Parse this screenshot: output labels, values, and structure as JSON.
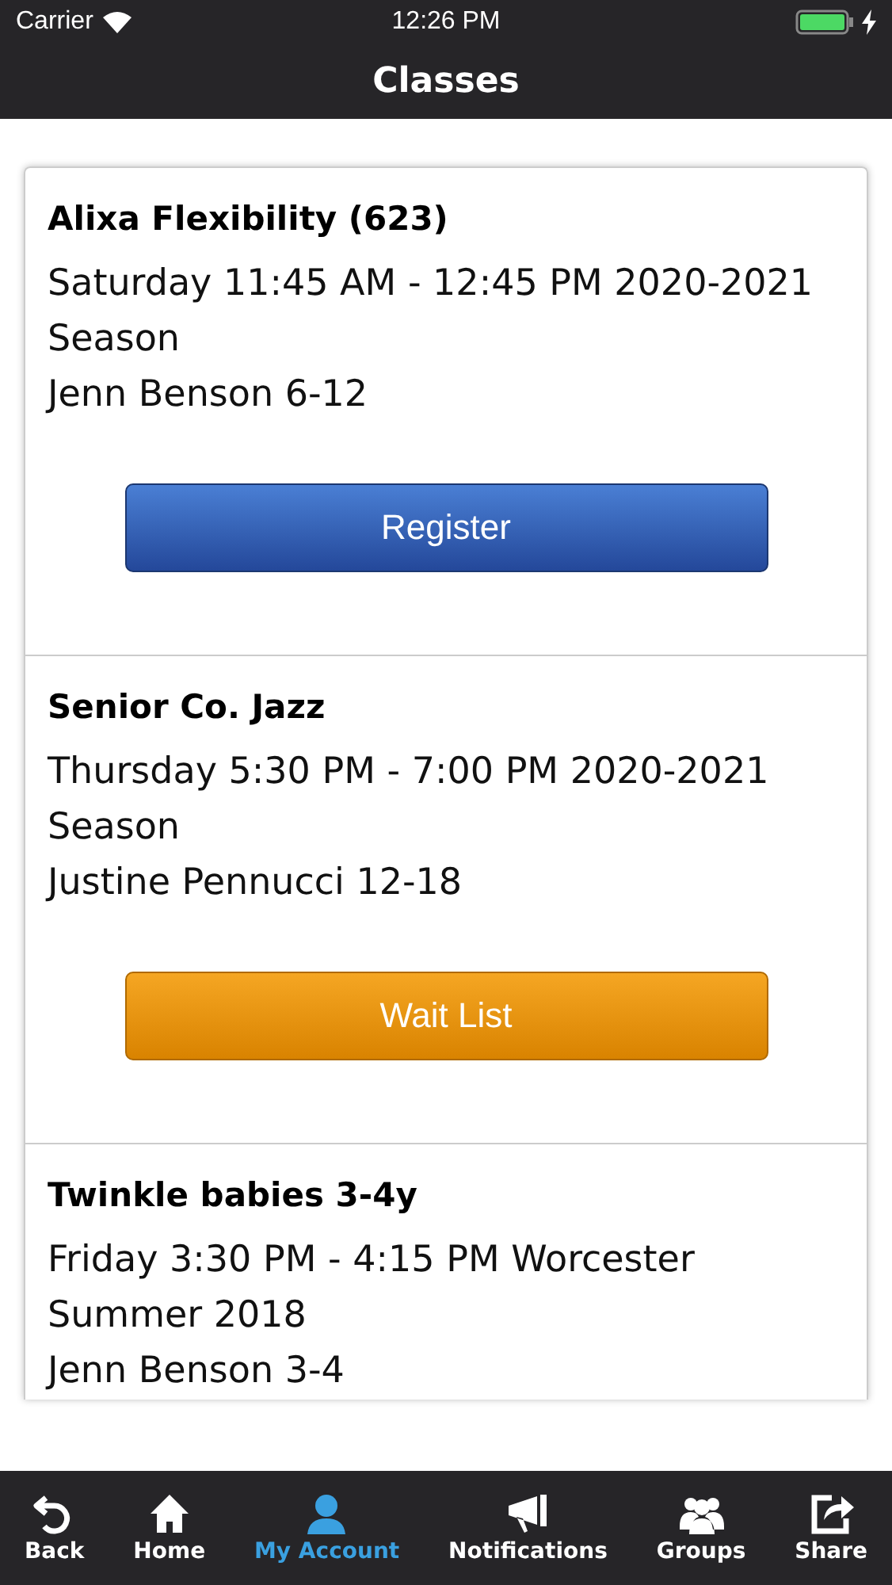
{
  "status_bar": {
    "carrier": "Carrier",
    "time": "12:26 PM"
  },
  "nav_bar": {
    "title": "Classes"
  },
  "classes": [
    {
      "title": "Alixa Flexibility (623)",
      "schedule": "Saturday 11:45 AM - 12:45 PM 2020-2021 Season",
      "instructor": "Jenn Benson 6-12",
      "button": {
        "label": "Register",
        "kind": "register"
      }
    },
    {
      "title": "Senior Co. Jazz",
      "schedule": "Thursday 5:30 PM - 7:00 PM 2020-2021 Season",
      "instructor": "Justine Pennucci 12-18",
      "button": {
        "label": "Wait List",
        "kind": "waitlist"
      }
    },
    {
      "title": "Twinkle babies 3-4y",
      "schedule": "Friday 3:30 PM - 4:15 PM Worcester Summer 2018",
      "instructor": "Jenn Benson 3-4"
    }
  ],
  "tab_bar": [
    {
      "label": "Back",
      "kind": "back",
      "selected": false
    },
    {
      "label": "Home",
      "kind": "home",
      "selected": false
    },
    {
      "label": "My Account",
      "kind": "account",
      "selected": true
    },
    {
      "label": "Notifications",
      "kind": "notifications",
      "selected": false
    },
    {
      "label": "Groups",
      "kind": "groups",
      "selected": false
    },
    {
      "label": "Share",
      "kind": "share",
      "selected": false
    }
  ]
}
